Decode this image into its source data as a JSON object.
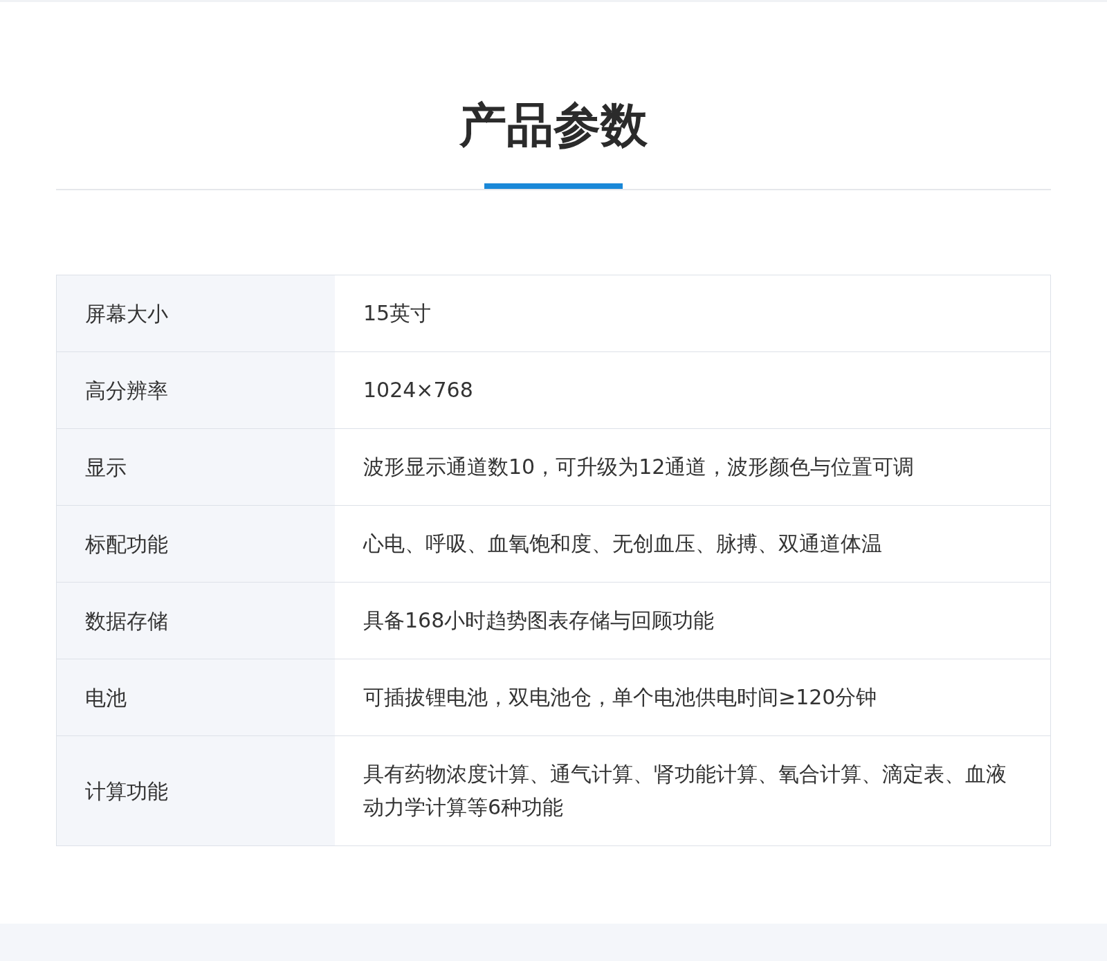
{
  "title": "产品参数",
  "rows": [
    {
      "label": "屏幕大小",
      "value": "15英寸"
    },
    {
      "label": "高分辨率",
      "value": "1024×768"
    },
    {
      "label": "显示",
      "value": "波形显示通道数10，可升级为12通道，波形颜色与位置可调"
    },
    {
      "label": "标配功能",
      "value": "心电、呼吸、血氧饱和度、无创血压、脉搏、双通道体温"
    },
    {
      "label": "数据存储",
      "value": "具备168小时趋势图表存储与回顾功能"
    },
    {
      "label": "电池",
      "value": "可插拔锂电池，双电池仓，单个电池供电时间≥120分钟"
    },
    {
      "label": "计算功能",
      "value": "具有药物浓度计算、通气计算、肾功能计算、氧合计算、滴定表、血液动力学计算等6种功能"
    }
  ]
}
